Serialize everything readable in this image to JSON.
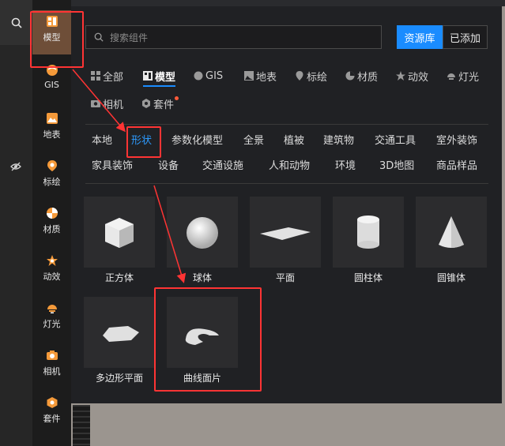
{
  "sidebar": {
    "items": [
      {
        "label": "模型",
        "icon": "model-icon"
      },
      {
        "label": "GIS",
        "icon": "gis-icon"
      },
      {
        "label": "地表",
        "icon": "terrain-icon"
      },
      {
        "label": "标绘",
        "icon": "plot-icon"
      },
      {
        "label": "材质",
        "icon": "material-icon"
      },
      {
        "label": "动效",
        "icon": "effect-icon"
      },
      {
        "label": "灯光",
        "icon": "light-icon"
      },
      {
        "label": "相机",
        "icon": "camera-icon"
      },
      {
        "label": "套件",
        "icon": "kit-icon"
      }
    ]
  },
  "search": {
    "placeholder": "搜索组件"
  },
  "source": {
    "library": "资源库",
    "added": "已添加"
  },
  "tabs": [
    "全部",
    "模型",
    "GIS",
    "地表",
    "标绘",
    "材质",
    "动效",
    "灯光",
    "相机",
    "套件"
  ],
  "subcategories": [
    "本地",
    "形状",
    "参数化模型",
    "全景",
    "植被",
    "建筑物",
    "交通工具",
    "室外装饰",
    "家具装饰",
    "设备",
    "交通设施",
    "人和动物",
    "环境",
    "3D地图",
    "商品样品"
  ],
  "shapes": [
    "正方体",
    "球体",
    "平面",
    "圆柱体",
    "圆锥体",
    "多边形平面",
    "曲线面片"
  ],
  "colors": {
    "accent": "#1a8cff",
    "highlight": "#ff3434",
    "active_sidebar": "#6e4e38"
  }
}
